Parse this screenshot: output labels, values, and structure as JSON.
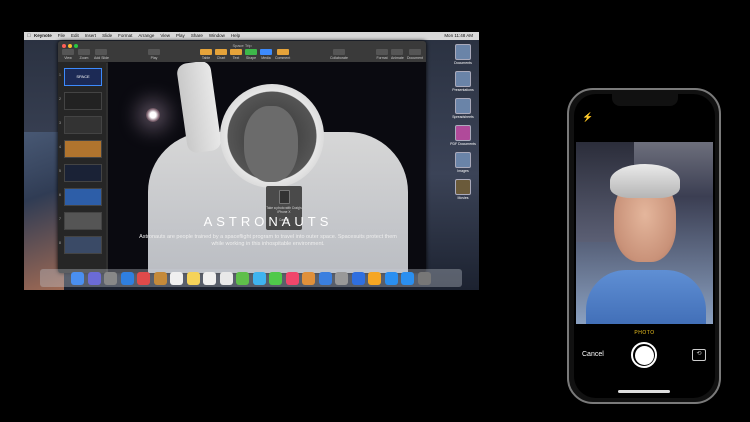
{
  "mac": {
    "menubar": {
      "apple": "",
      "app": "Keynote",
      "items": [
        "File",
        "Edit",
        "Insert",
        "Slide",
        "Format",
        "Arrange",
        "View",
        "Play",
        "Share",
        "Window",
        "Help"
      ],
      "clock": "Mon 11:48 AM"
    },
    "window": {
      "title": "Space Trip",
      "toolbar": [
        {
          "label": "View"
        },
        {
          "label": "Zoom"
        },
        {
          "label": "Add Slide"
        },
        {
          "label": "Play"
        },
        {
          "label": "Table"
        },
        {
          "label": "Chart"
        },
        {
          "label": "Text"
        },
        {
          "label": "Shape"
        },
        {
          "label": "Media"
        },
        {
          "label": "Comment"
        },
        {
          "label": "Collaborate"
        },
        {
          "label": "Format"
        },
        {
          "label": "Animate"
        },
        {
          "label": "Document"
        }
      ],
      "slides": [
        {
          "num": "1",
          "text": "SPACE"
        },
        {
          "num": "2",
          "text": ""
        },
        {
          "num": "3",
          "text": ""
        },
        {
          "num": "4",
          "text": ""
        },
        {
          "num": "5",
          "text": ""
        },
        {
          "num": "6",
          "text": ""
        },
        {
          "num": "7",
          "text": ""
        },
        {
          "num": "8",
          "text": ""
        }
      ]
    },
    "slide": {
      "title": "ASTRONAUTS",
      "body": "Astronauts are people trained by a spaceflight program to travel into outer space. Spacesuits protect them while working in this inhospitable environment."
    },
    "airdrop_popover": {
      "text": "Take a photo with Craig's iPhone X",
      "cancel": "Cancel"
    },
    "desktop_items": [
      "Documents",
      "Presentations",
      "Spreadsheets",
      "PDF Documents",
      "Images",
      "Movies"
    ],
    "dock_colors": [
      "#4a8ff0",
      "#6b6bd6",
      "#888",
      "#2f7fe0",
      "#e04a4a",
      "#c58a3a",
      "#f0f0f0",
      "#f5d35a",
      "#f0f0f0",
      "#e9e9e9",
      "#5fbf4a",
      "#3fb4f0",
      "#4fc94a",
      "#f0466b",
      "#e0903a",
      "#3a7fe0",
      "#999",
      "#2f6fe0",
      "#f5a623",
      "#2a8ff0",
      "#2a8ff0",
      "#777"
    ]
  },
  "phone": {
    "flash_icon": "⚡",
    "mode": "PHOTO",
    "cancel": "Cancel",
    "switch_icon": "⟲"
  }
}
